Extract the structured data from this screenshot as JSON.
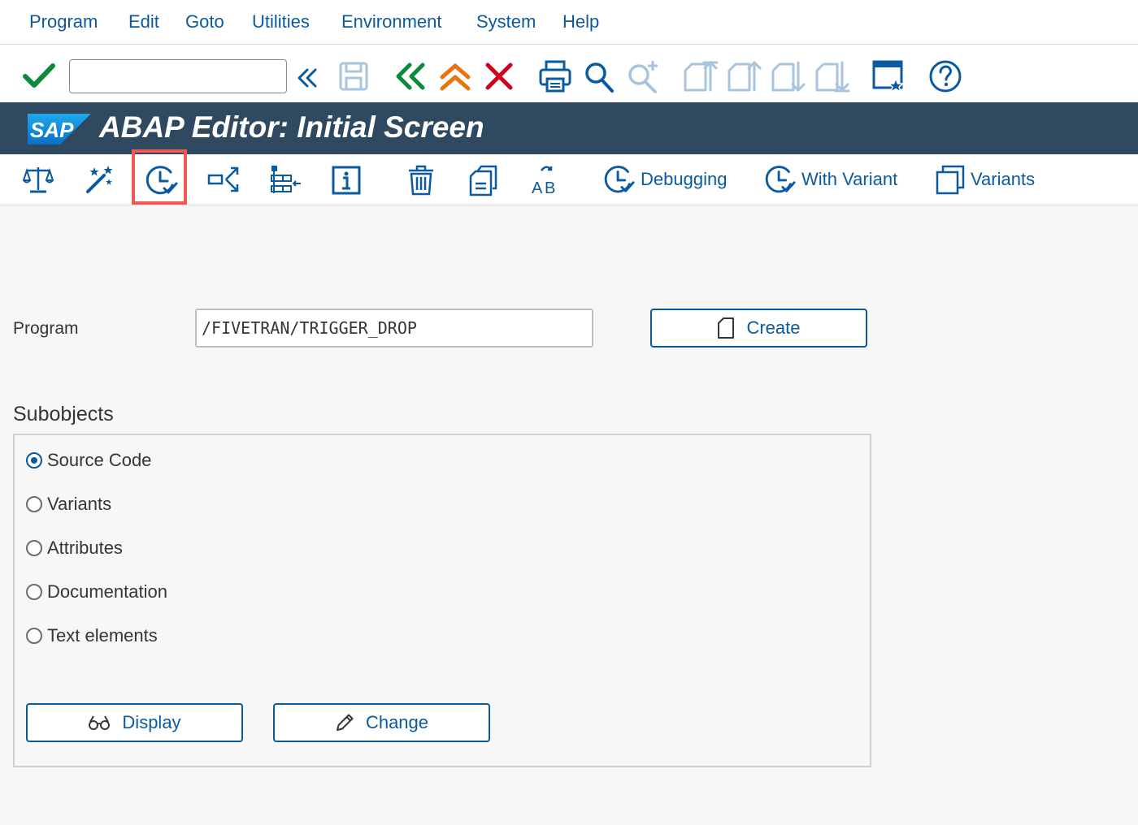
{
  "menu": {
    "items": [
      {
        "label": "Program"
      },
      {
        "label": "Edit"
      },
      {
        "label": "Goto"
      },
      {
        "label": "Utilities"
      },
      {
        "label": "Environment"
      },
      {
        "label": "System"
      },
      {
        "label": "Help"
      }
    ]
  },
  "system_toolbar": {
    "command_field_value": "",
    "icons": [
      "enter-checkmark-icon",
      "command-history-icon",
      "save-icon",
      "back-icon",
      "exit-icon",
      "cancel-icon",
      "print-icon",
      "find-icon",
      "find-next-icon",
      "first-page-icon",
      "previous-page-icon",
      "next-page-icon",
      "last-page-icon",
      "customize-layout-icon",
      "help-icon"
    ]
  },
  "title_bar": {
    "logo_text": "SAP",
    "title": "ABAP Editor: Initial Screen"
  },
  "app_toolbar": {
    "debugging_label": "Debugging",
    "with_variant_label": "With Variant",
    "variants_label": "Variants",
    "highlighted_icon": "execute-icon"
  },
  "form": {
    "program_label": "Program",
    "program_value": "/FIVETRAN/TRIGGER_DROP",
    "create_label": "Create"
  },
  "subobjects": {
    "title": "Subobjects",
    "options": [
      {
        "label": "Source Code",
        "selected": true
      },
      {
        "label": "Variants",
        "selected": false
      },
      {
        "label": "Attributes",
        "selected": false
      },
      {
        "label": "Documentation",
        "selected": false
      },
      {
        "label": "Text elements",
        "selected": false
      }
    ],
    "display_label": "Display",
    "change_label": "Change"
  },
  "colors": {
    "accent": "#0a5aa0",
    "title_bar": "#2f4a60",
    "highlight": "#f15a52",
    "enter_green": "#0a8a3a",
    "exit_orange": "#e9730c",
    "cancel_red": "#d0021b"
  }
}
